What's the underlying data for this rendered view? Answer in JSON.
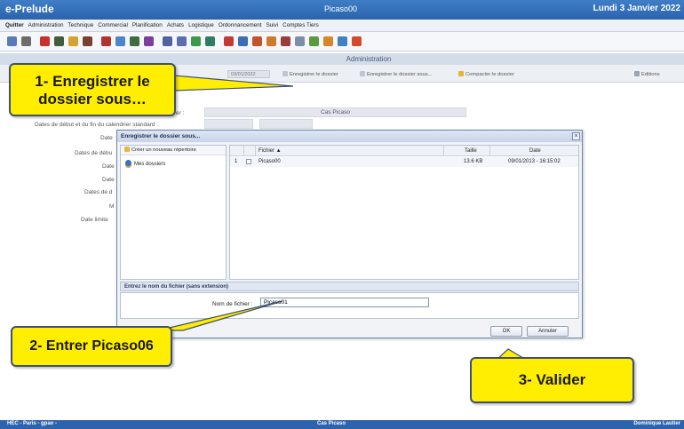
{
  "titlebar": {
    "app_name": "e-Prelude",
    "document": "Picaso00",
    "date": "Lundi 3 Janvier 2022"
  },
  "menu": [
    "Quitter",
    "Administration",
    "Technique",
    "Commercial",
    "Planification",
    "Achats",
    "Logistique",
    "Ordonnancement",
    "Suivi",
    "Comptes Tiers"
  ],
  "toolbar_icons": [
    "save-icon",
    "print-icon",
    "red-tool-icon",
    "book-icon",
    "folder-icon",
    "gear-icon",
    "chart-icon",
    "globe-icon",
    "grid-icon",
    "bar-chart-icon",
    "settings-icon",
    "star-icon",
    "monitor-icon",
    "truck-icon",
    "target-icon",
    "table-icon",
    "gauge-icon",
    "tools-icon",
    "network-icon",
    "puzzle-icon",
    "group-icon",
    "people-icon",
    "question-icon",
    "exit-icon"
  ],
  "admin": {
    "title": "Administration",
    "date_chip": "03/01/2022",
    "save": "Enregistrer le dossier",
    "save_as": "Enregistrer le dossier sous...",
    "compact": "Compacter le dossier",
    "editions": "Editions"
  },
  "form": {
    "dossier_label": "er :",
    "dossier_value": "Cas Picaso",
    "dates_label": "Dates de début et du fin du calendrier standard :",
    "labels": [
      "Date",
      "Dates de débu",
      "Date",
      "Date",
      "Dates de d",
      "M",
      "Date limite"
    ]
  },
  "dialog": {
    "title": "Enregistrer le dossier sous...",
    "close": "×",
    "new_dir": "Créer un nouveau répertoire",
    "my_docs": "Mes dossiers",
    "col_file": "Fichier ▲",
    "col_size": "Taille",
    "col_date": "Date",
    "rows": [
      {
        "index": "1",
        "name": "Picaso00",
        "size": "13.6 KB",
        "date": "09/01/2013 - 16:15:02"
      }
    ],
    "section": "Entrez le nom du fichier (sans extension)",
    "fname_label": "Nom de fichier :",
    "fname_value": "Picaso01",
    "ok": "OK",
    "cancel": "Annuler"
  },
  "status": {
    "left": "HEC - Paris - gpao -",
    "center": "Cas Picaso",
    "right": "Dominique Lautier"
  },
  "callouts": {
    "c1_line1": "1- Enregistrer le",
    "c1_line2": "dossier sous…",
    "c2": "2- Entrer Picaso06",
    "c3": "3- Valider"
  },
  "colors": {
    "title_blue": "#2b63ad",
    "callout_yellow": "#ffee00",
    "callout_border": "#3f4f72"
  }
}
